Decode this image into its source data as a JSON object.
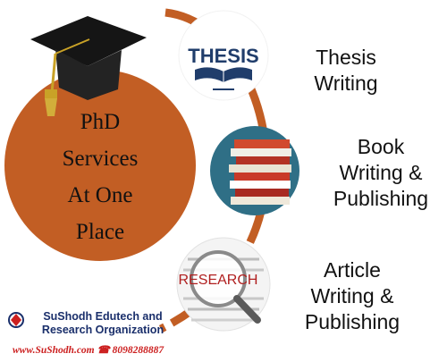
{
  "main_circle": {
    "lines": [
      "PhD",
      "Services",
      "At One",
      "Place"
    ]
  },
  "services": [
    {
      "lines": [
        "Thesis",
        "Writing"
      ],
      "icon": "thesis-logo-icon"
    },
    {
      "lines": [
        "Book",
        "Writing &",
        "Publishing"
      ],
      "icon": "book-stack-icon"
    },
    {
      "lines": [
        "Article",
        "Writing &",
        "Publishing"
      ],
      "icon": "research-magnifier-icon"
    }
  ],
  "thesis_logo_text": "THESIS",
  "research_logo_text": "RESEARCH",
  "organization": {
    "name_line1": "SuShodh Edutech and",
    "name_line2": "Research Organization",
    "contact": "www.SuShodh.com ☎ 8098288887"
  },
  "colors": {
    "circle": "#c25e24",
    "arc": "#c25e24",
    "cap": "#151515",
    "tassel": "#c9a227",
    "thesis_text": "#203d6b",
    "research_text": "#b01f1f",
    "org_text": "#1a2f6b",
    "contact_text": "#cc1f1f"
  }
}
